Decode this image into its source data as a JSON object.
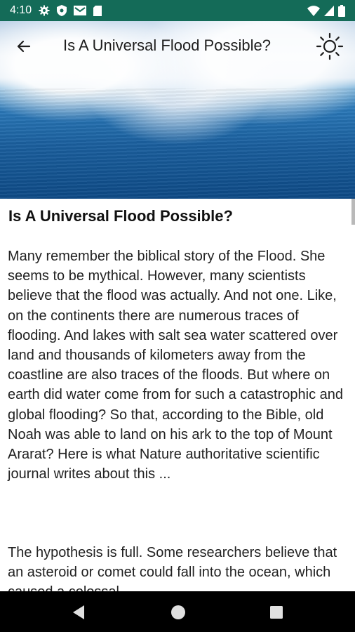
{
  "status_bar": {
    "time": "4:10",
    "left_icons": [
      "gear-icon",
      "shield-icon",
      "mail-icon",
      "sd-card-icon"
    ],
    "right_icons": [
      "wifi-icon",
      "signal-icon",
      "battery-icon"
    ]
  },
  "toolbar": {
    "title": "Is A Universal Flood Possible?",
    "back_icon": "arrow-left-icon",
    "theme_icon": "sun-icon"
  },
  "article": {
    "title": "Is A Universal Flood Possible?",
    "paragraph1": "Many remember the biblical story of the Flood. She seems to be mythical. However, many scientists believe that the flood was actually. And not one. Like, on the continents there are numerous traces of flooding. And lakes with salt sea water scattered over land and thousands of kilometers away from the coastline are also traces of the floods. But where on earth did water come from for such a catastrophic and global flooding? So that, according to the Bible, old Noah was able to land on his ark to the top of Mount Ararat? Here is what Nature authoritative scientific journal writes about this ...",
    "paragraph2": "The hypothesis is full. Some researchers believe that an asteroid or comet could fall into the ocean, which caused a colossal"
  },
  "nav_bar": {
    "icons": [
      "back-triangle-icon",
      "home-circle-icon",
      "recents-square-icon"
    ]
  },
  "colors": {
    "status_bar": "#146b58",
    "nav_bar": "#000000",
    "text": "#222222"
  }
}
